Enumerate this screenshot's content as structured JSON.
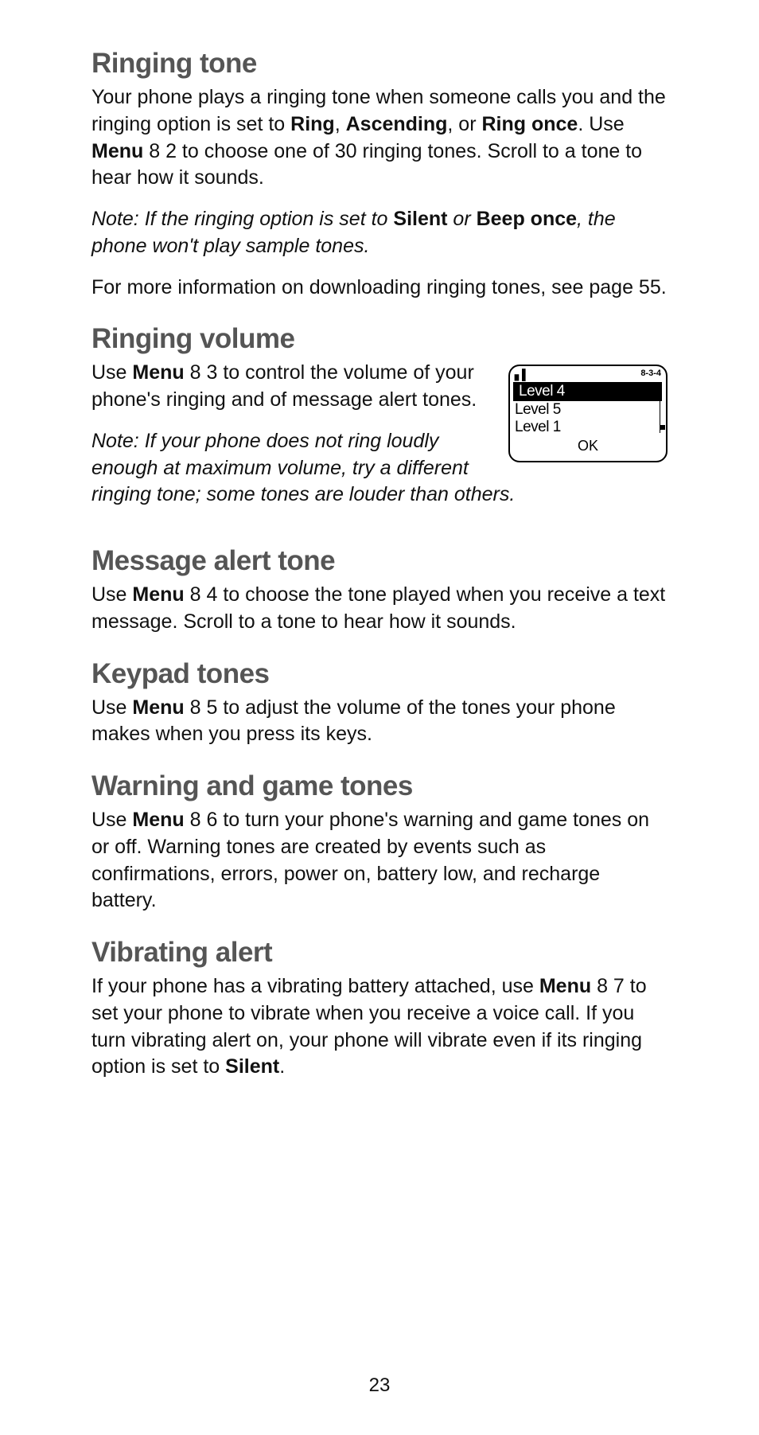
{
  "page_number": "23",
  "sections": {
    "ringing_tone": {
      "heading": "Ringing tone",
      "p1_a": "Your phone plays a ringing tone when someone calls you and the ringing option is set to ",
      "p1_b1": "Ring",
      "p1_c": ", ",
      "p1_b2": "Ascending",
      "p1_d": ", or ",
      "p1_b3": "Ring once",
      "p1_e": ". Use ",
      "p1_menu": "Menu",
      "p1_f": " 8 2 to choose one of 30 ringing tones. Scroll to a tone to hear how it sounds.",
      "note_a": "Note:  If the ringing option is set to ",
      "note_b1": "Silent",
      "note_b": " or ",
      "note_b2": "Beep once",
      "note_c": ", the phone won't play sample tones.",
      "p3": "For more information on downloading ringing tones, see page 55."
    },
    "ringing_volume": {
      "heading": "Ringing volume",
      "p1_a": "Use ",
      "p1_menu": "Menu",
      "p1_b": " 8 3 to control the volume of your phone's ringing and of message alert tones.",
      "note": "Note:  If your phone does not ring loudly enough at maximum volume, try a different ringing tone; some tones are louder than others."
    },
    "message_alert": {
      "heading": "Message alert tone",
      "p1_a": "Use ",
      "p1_menu": "Menu",
      "p1_b": " 8 4 to choose the tone played when you receive a text message. Scroll to a tone to hear how it sounds."
    },
    "keypad": {
      "heading": "Keypad tones",
      "p1_a": "Use ",
      "p1_menu": "Menu",
      "p1_b": " 8 5 to adjust the volume of the tones your phone makes when you press its keys."
    },
    "warning": {
      "heading": "Warning and game tones",
      "p1_a": "Use ",
      "p1_menu": "Menu",
      "p1_b": " 8 6 to turn your phone's warning and game tones on or off. Warning tones are created by events such as confirmations, errors, power on, battery low, and recharge battery."
    },
    "vibrating": {
      "heading": "Vibrating alert",
      "p1_a": "If your phone has a vibrating battery attached, use ",
      "p1_menu": "Menu",
      "p1_b": " 8 7 to set your phone to vibrate when you receive a voice call. If you turn vibrating alert on, your phone will vibrate even if its ringing option is set to ",
      "p1_silent": "Silent",
      "p1_c": "."
    }
  },
  "screen": {
    "code": "8-3-4",
    "signal": "▖▘",
    "rows": [
      "Level 4",
      "Level 5",
      "Level 1"
    ],
    "ok": "OK"
  }
}
